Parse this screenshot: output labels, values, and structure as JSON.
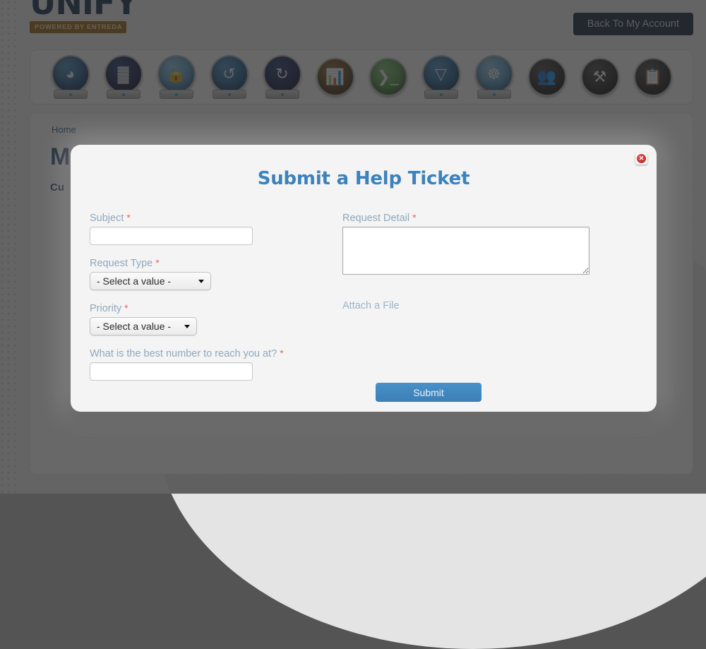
{
  "header": {
    "logo_word": "UNIFY",
    "logo_tagline": "POWERED BY ENTREDA",
    "account_button": "Back To My Account"
  },
  "toolbar": {
    "icons": [
      {
        "name": "wireless-icon",
        "glyph": "◔"
      },
      {
        "name": "firewall-icon",
        "glyph": "▓"
      },
      {
        "name": "vpn-lock-icon",
        "glyph": "🔒"
      },
      {
        "name": "cloud-restore-icon",
        "glyph": "↺"
      },
      {
        "name": "cloud-sync-icon",
        "glyph": "↻"
      },
      {
        "name": "reports-icon",
        "glyph": "📊"
      },
      {
        "name": "secure-terminal-icon",
        "glyph": "❯_"
      },
      {
        "name": "content-filter-icon",
        "glyph": "▽"
      },
      {
        "name": "network-map-icon",
        "glyph": "☸"
      },
      {
        "name": "users-icon",
        "glyph": "👥"
      },
      {
        "name": "tools-icon",
        "glyph": "⚒"
      },
      {
        "name": "checklist-icon",
        "glyph": "📋"
      }
    ]
  },
  "page": {
    "breadcrumb": "Home",
    "title": "M",
    "subtitle": "Cu"
  },
  "modal": {
    "title": "Submit a Help Ticket",
    "close_glyph": "✕",
    "required_marker": "*",
    "fields": {
      "subject": {
        "label": "Subject",
        "value": "",
        "placeholder": ""
      },
      "request_type": {
        "label": "Request Type",
        "selected": "- Select a value -"
      },
      "priority": {
        "label": "Priority",
        "selected": "- Select a value -"
      },
      "phone": {
        "label": "What is the best number to reach you at?",
        "value": "",
        "placeholder": ""
      },
      "request_detail": {
        "label": "Request Detail",
        "value": "",
        "placeholder": ""
      },
      "attach": {
        "label": "Attach a File"
      }
    },
    "submit_label": "Submit"
  },
  "colors": {
    "modal_title": "#3b82be",
    "label": "#8fa7bd",
    "required": "#e8645c",
    "submit": "#3a7fb5",
    "logo_navy": "#17324f",
    "logo_bronze": "#9a6a12",
    "overlay": "rgba(40,40,40,0.70)"
  }
}
